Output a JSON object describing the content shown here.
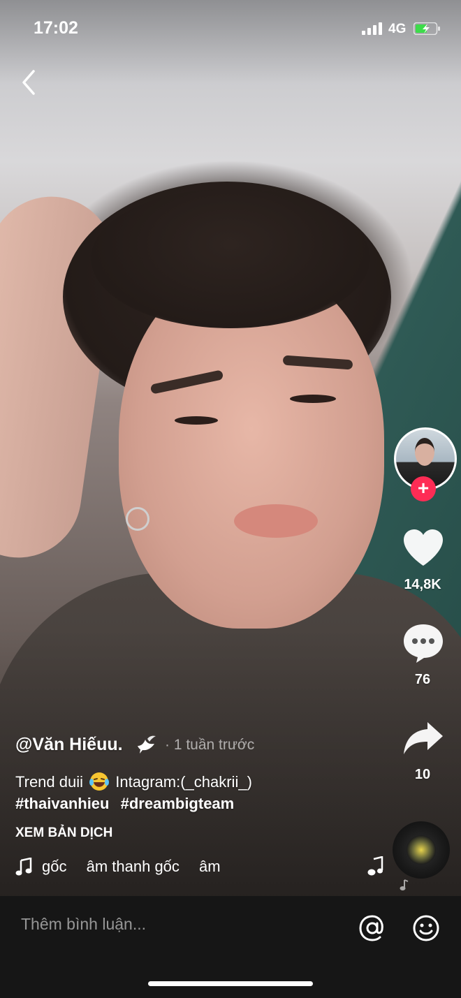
{
  "status_bar": {
    "time": "17:02",
    "network": "4G"
  },
  "video": {
    "author": "@Văn Hiếuu.",
    "time_ago": "· 1 tuần trước",
    "description_before_emoji": "Trend duii",
    "description_after_emoji": "Intagram:(_chakrii_)",
    "hashtags": [
      "#thaivanhieu",
      "#dreambigteam"
    ],
    "translate_label": "XEM BẢN DỊCH",
    "music_marquee": [
      "gốc",
      "âm thanh gốc",
      "âm"
    ]
  },
  "actions": {
    "likes": "14,8K",
    "comments": "76",
    "shares": "10",
    "follow_symbol": "+"
  },
  "comment_bar": {
    "placeholder": "Thêm bình luận..."
  },
  "colors": {
    "accent": "#fe2c55",
    "comment_bar_bg": "#161616"
  }
}
